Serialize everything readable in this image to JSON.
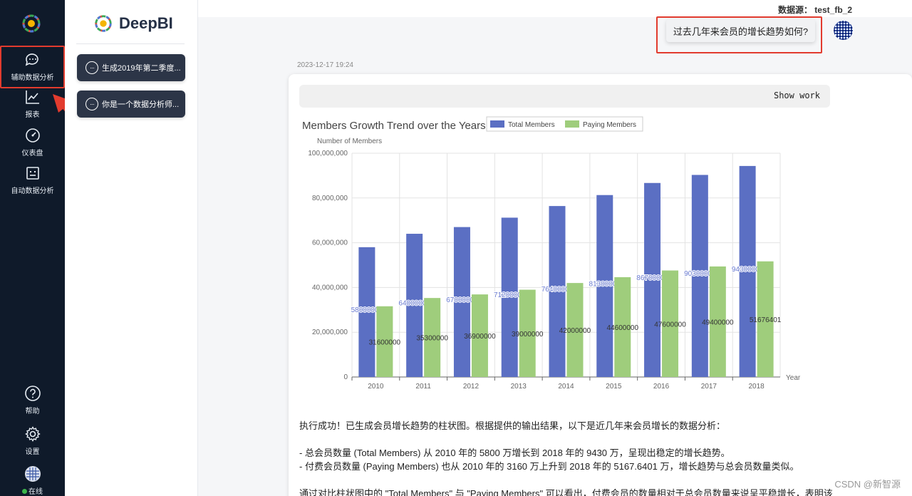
{
  "sidebar": {
    "items": [
      {
        "label": "辅助数据分析",
        "icon": "chat-icon"
      },
      {
        "label": "报表",
        "icon": "line-chart-icon"
      },
      {
        "label": "仪表盘",
        "icon": "gauge-icon"
      },
      {
        "label": "自动数据分析",
        "icon": "robot-icon"
      }
    ],
    "bottom": [
      {
        "label": "帮助",
        "icon": "help-icon"
      },
      {
        "label": "设置",
        "icon": "gear-icon"
      },
      {
        "label": "在线",
        "icon": "avatar-icon"
      }
    ]
  },
  "brand": {
    "name": "DeepBI"
  },
  "conversations": [
    {
      "label": "生成2019年第二季度..."
    },
    {
      "label": "你是一个数据分析师..."
    }
  ],
  "header": {
    "datasource": "数据源： test_fb_2"
  },
  "chat": {
    "question": "过去几年来会员的增长趋势如何?",
    "timestamp": "2023-12-17 19:24",
    "show_work": "Show work"
  },
  "chart_data": {
    "type": "bar",
    "title": "Members Growth Trend over the Years",
    "xlabel": "Year",
    "ylabel": "Number of Members",
    "categories": [
      "2010",
      "2011",
      "2012",
      "2013",
      "2014",
      "2015",
      "2016",
      "2017",
      "2018"
    ],
    "series": [
      {
        "name": "Total Members",
        "color": "#5b6fc3",
        "values": [
          58000000,
          64000000,
          67000000,
          71200000,
          76400000,
          81300000,
          86700000,
          90300000,
          94300000
        ]
      },
      {
        "name": "Paying Members",
        "color": "#9fcd7c",
        "values": [
          31600000,
          35300000,
          36900000,
          39000000,
          42000000,
          44600000,
          47600000,
          49400000,
          51676401
        ]
      }
    ],
    "ylim": [
      0,
      100000000
    ],
    "yticks": [
      "0",
      "20,000,000",
      "40,000,000",
      "60,000,000",
      "80,000,000",
      "100,000,000"
    ],
    "grid": true,
    "legend": "top"
  },
  "result": {
    "line1": "执行成功！已生成会员增长趋势的柱状图。根据提供的输出结果，以下是近几年来会员增长的数据分析：",
    "line2": "- 总会员数量 (Total Members) 从 2010 年的 5800 万增长到 2018 年的 9430 万，呈现出稳定的增长趋势。",
    "line3": "- 付费会员数量 (Paying Members) 也从 2010 年的 3160 万上升到 2018 年的 5167.6401 万，增长趋势与总会员数量类似。",
    "line4": "通过对比柱状图中的 \"Total Members\" 与 \"Paying Members\" 可以看出，付费会员的数量相对于总会员数量来说呈平稳增长，表明该"
  },
  "watermark": "CSDN @新智源"
}
